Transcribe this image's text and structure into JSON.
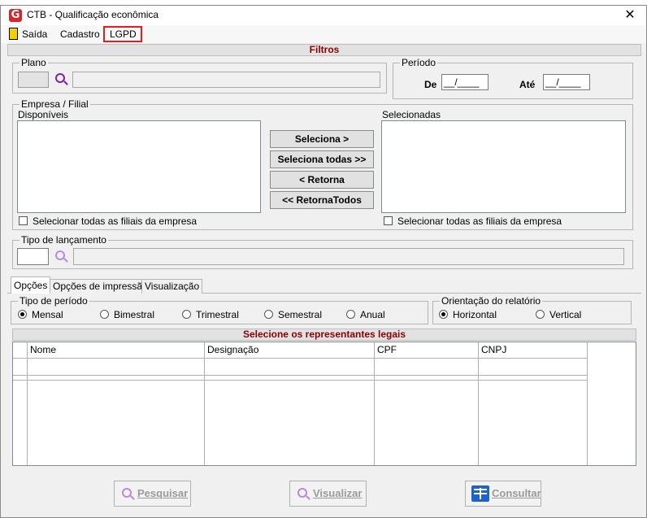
{
  "window": {
    "title": "CTB - Qualificação econômica"
  },
  "menu": [
    {
      "label": "Saída"
    },
    {
      "label": "Cadastro"
    },
    {
      "label": "LGPD"
    }
  ],
  "filters": {
    "title": "Filtros",
    "plano": {
      "label": "Plano",
      "code": "",
      "description": ""
    },
    "periodo": {
      "label": "Período",
      "de_label": "De",
      "de_value": "__/____",
      "ate_label": "Até",
      "ate_value": "__/____"
    },
    "empresa": {
      "label": "Empresa / Filial",
      "disponiveis_label": "Disponíveis",
      "selecionadas_label": "Selecionadas",
      "disponiveis": [],
      "selecionadas": [],
      "check_left": "Selecionar todas as filiais da empresa",
      "check_right": "Selecionar todas as filiais da empresa",
      "buttons": {
        "seleciona": "Seleciona >",
        "seleciona_todas": "Seleciona todas >>",
        "retorna": "< Retorna",
        "retorna_todos": "<< RetornaTodos"
      }
    },
    "tipo_lancamento": {
      "label": "Tipo de  lançamento",
      "code": "",
      "description": ""
    }
  },
  "tabs": [
    {
      "label": "Opções",
      "active": true
    },
    {
      "label": "Opções de impressão",
      "active": false
    },
    {
      "label": "Visualização",
      "active": false
    }
  ],
  "opcoes": {
    "tipo_periodo": {
      "label": "Tipo de período",
      "options": [
        "Mensal",
        "Bimestral",
        "Trimestral",
        "Semestral",
        "Anual"
      ],
      "selected": "Mensal"
    },
    "orientacao": {
      "label": "Orientação do relatório",
      "options": [
        "Horizontal",
        "Vertical"
      ],
      "selected": "Horizontal"
    }
  },
  "representantes": {
    "title": "Selecione os representantes legais",
    "columns": [
      "Nome",
      "Designação",
      "CPF",
      "CNPJ"
    ],
    "rows": []
  },
  "actions": {
    "pesquisar": "Pesquisar",
    "visualizar": "Visualizar",
    "consultar": "Consultar"
  },
  "colors": {
    "section_title": "#8b0000",
    "search_icon": "#7b20b0",
    "highlight_border": "#e0201c"
  }
}
